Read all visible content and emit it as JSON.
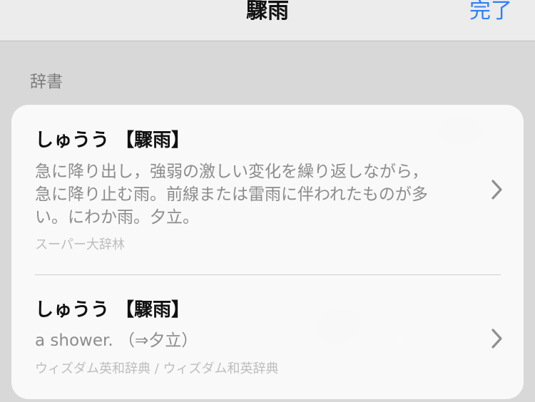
{
  "navbar": {
    "title": "驟雨",
    "done_label": "完了"
  },
  "section": {
    "header": "辞書"
  },
  "entries": [
    {
      "title": "しゅうう 【驟雨】",
      "definition_lines": [
        "急に降り出し，強弱の激しい変化を繰り返しながら，",
        "急に降り止む雨。前線または雷雨に伴われたものが多",
        "い。にわか雨。夕立。"
      ],
      "source": "スーパー大辞林",
      "chevron_icon": "chevron-right-icon"
    },
    {
      "title": "しゅうう 【驟雨】",
      "definition": "a shower. （⇒夕立）",
      "source": "ウィズダム英和辞典 / ウィズダム和英辞典",
      "chevron_icon": "chevron-right-icon"
    }
  ],
  "colors": {
    "accent": "#2f7ef6",
    "secondary_text": "#8c8c8c",
    "tertiary_text": "#bdbdbd"
  }
}
